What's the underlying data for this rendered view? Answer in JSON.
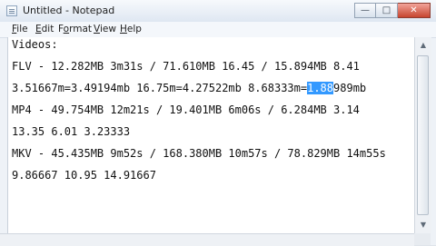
{
  "window": {
    "title": "Untitled - Notepad",
    "buttons": {
      "minimize": "—",
      "maximize": "□",
      "close": "✕"
    }
  },
  "menu": [
    {
      "label": "File",
      "mnemonic": "F",
      "rest": "ile"
    },
    {
      "label": "Edit",
      "mnemonic": "E",
      "rest": "dit"
    },
    {
      "label": "Format",
      "mnemonic": "o",
      "pre": "F",
      "rest": "rmat"
    },
    {
      "label": "View",
      "mnemonic": "V",
      "rest": "iew"
    },
    {
      "label": "Help",
      "mnemonic": "H",
      "rest": "elp"
    }
  ],
  "editor": {
    "lines": [
      "Videos:",
      "FLV - 12.282MB 3m31s / 71.610MB 16.45 / 15.894MB 8.41",
      "3.51667m=3.49194mb 16.75m=4.27522mb 8.68333m=",
      "MP4 - 49.754MB 12m21s / 19.401MB 6m06s / 6.284MB 3.14",
      "13.35 6.01 3.23333",
      "MKV - 45.435MB 9m52s / 168.380MB 10m57s / 78.829MB 14m55s",
      "9.86667 10.95 14.91667"
    ],
    "selected_text": "1.88",
    "after_selection": "989mb"
  },
  "icons": {
    "app": "notepad-icon",
    "scroll_up": "scroll-up-arrow-icon",
    "scroll_down": "scroll-down-arrow-icon"
  }
}
